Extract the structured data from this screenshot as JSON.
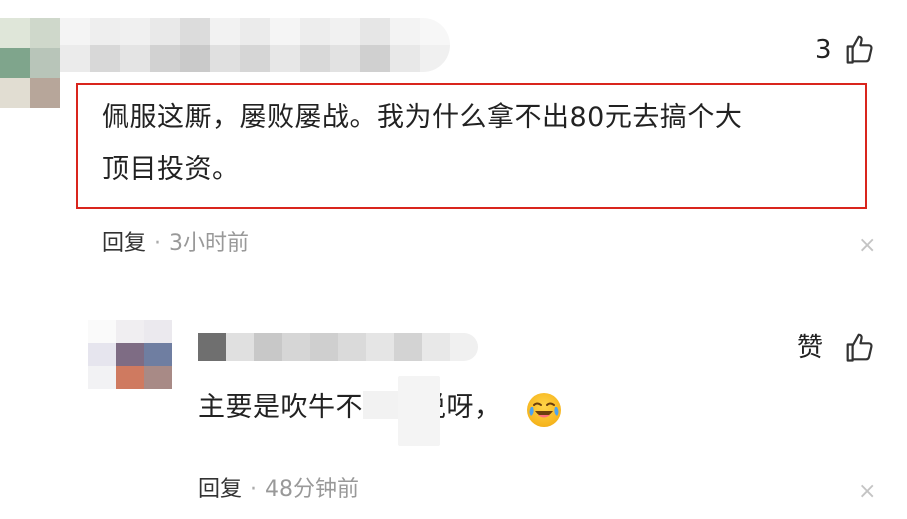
{
  "comment": {
    "like_count": "3",
    "text_line1": "佩服这厮，屡败屡战。我为什么拿不出80元去搞个大",
    "text_line2": "顶目投资。",
    "reply_label": "回复",
    "separator": "·",
    "time": "3小时前",
    "close": "×"
  },
  "reply": {
    "like_label": "赞",
    "text_before": "主要是吹牛不",
    "text_after": "说呀，",
    "emoji_icon": "crying-laughing-face-icon",
    "reply_label": "回复",
    "separator": "·",
    "time": "48分钟前",
    "close": "×"
  },
  "colors": {
    "highlight_border": "#d9251d",
    "muted_text": "#999999",
    "icon_stroke": "#333333"
  }
}
